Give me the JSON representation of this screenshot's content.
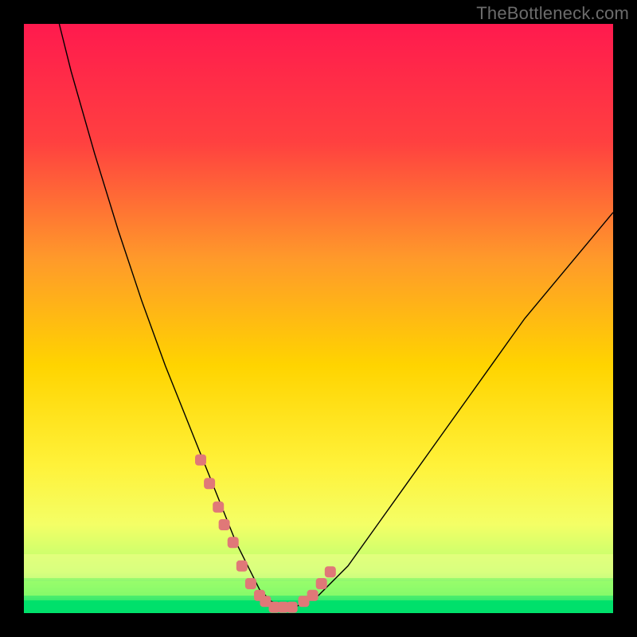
{
  "watermark": "TheBottleneck.com",
  "chart_data": {
    "type": "line",
    "title": "",
    "xlabel": "",
    "ylabel": "",
    "xlim": [
      0,
      100
    ],
    "ylim": [
      0,
      100
    ],
    "legend": false,
    "grid": false,
    "background_gradient": {
      "top": "#ff1a4e",
      "mid_upper": "#ff7a36",
      "mid": "#ffd400",
      "mid_lower": "#f2ff50",
      "green_band": "#9cff6a",
      "bottom": "#00e06b"
    },
    "series": [
      {
        "name": "bottleneck-curve",
        "color": "#000000",
        "stroke_width": 1.4,
        "x": [
          6,
          8,
          12,
          16,
          20,
          24,
          28,
          30,
          32,
          34,
          36,
          38,
          40,
          42,
          44,
          46,
          50,
          55,
          60,
          65,
          70,
          75,
          80,
          85,
          90,
          95,
          100
        ],
        "y": [
          100,
          92,
          78,
          65,
          53,
          42,
          32,
          27,
          22,
          17,
          12,
          8,
          4,
          2,
          1,
          1,
          3,
          8,
          15,
          22,
          29,
          36,
          43,
          50,
          56,
          62,
          68
        ]
      },
      {
        "name": "highlight-left-cluster",
        "color": "#e07878",
        "marker": "round",
        "marker_size": 14,
        "x": [
          30.0,
          31.5,
          33.0,
          34.0,
          35.5,
          37.0,
          38.5,
          40.0,
          41.0,
          42.5,
          44.0,
          45.5
        ],
        "y": [
          26,
          22,
          18,
          15,
          12,
          8,
          5,
          3,
          2,
          1,
          1,
          1
        ]
      },
      {
        "name": "highlight-right-cluster",
        "color": "#e07878",
        "marker": "round",
        "marker_size": 14,
        "x": [
          47.5,
          49.0,
          50.5,
          52.0
        ],
        "y": [
          2,
          3,
          5,
          7
        ]
      }
    ]
  }
}
